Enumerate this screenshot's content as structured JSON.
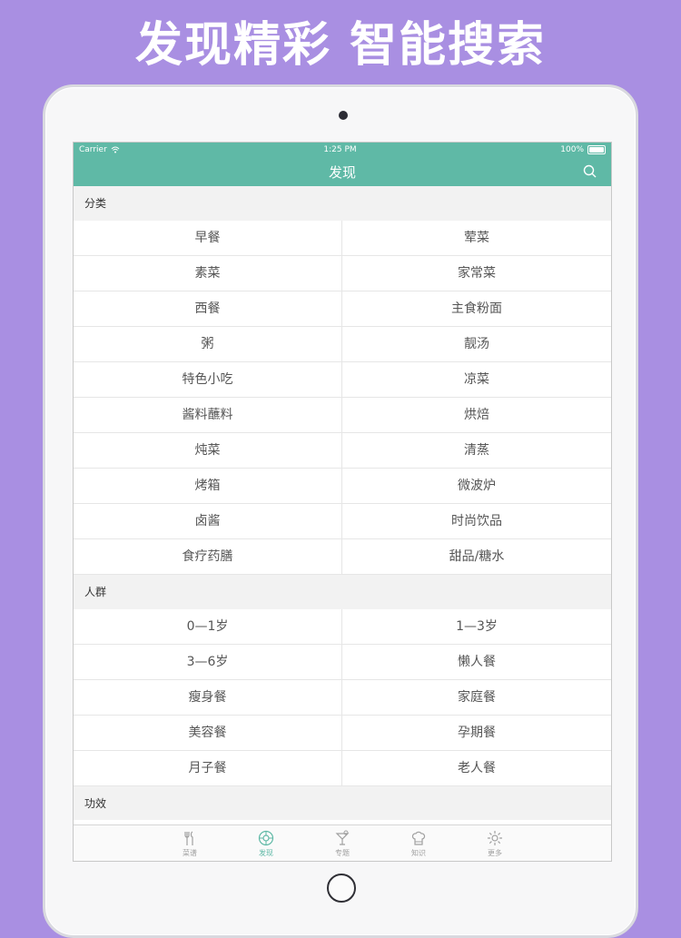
{
  "promo": {
    "title": "发现精彩 智能搜索"
  },
  "status": {
    "carrier": "Carrier",
    "time": "1:25 PM",
    "battery": "100%"
  },
  "nav": {
    "title": "发现",
    "search_icon": "search-icon"
  },
  "sections": [
    {
      "title": "分类",
      "items": [
        "早餐",
        "荤菜",
        "素菜",
        "家常菜",
        "西餐",
        "主食粉面",
        "粥",
        "靓汤",
        "特色小吃",
        "凉菜",
        "酱料蘸料",
        "烘焙",
        "炖菜",
        "清蒸",
        "烤箱",
        "微波炉",
        "卤酱",
        "时尚饮品",
        "食疗药膳",
        "甜品/糖水"
      ]
    },
    {
      "title": "人群",
      "items": [
        "0—1岁",
        "1—3岁",
        "3—6岁",
        "懒人餐",
        "瘦身餐",
        "家庭餐",
        "美容餐",
        "孕期餐",
        "月子餐",
        "老人餐"
      ]
    },
    {
      "title": "功效",
      "items": []
    }
  ],
  "tabs": [
    {
      "label": "菜谱",
      "icon": "utensils-icon",
      "active": false
    },
    {
      "label": "发现",
      "icon": "compass-icon",
      "active": true
    },
    {
      "label": "专题",
      "icon": "cocktail-icon",
      "active": false
    },
    {
      "label": "知识",
      "icon": "chef-hat-icon",
      "active": false
    },
    {
      "label": "更多",
      "icon": "gear-icon",
      "active": false
    }
  ],
  "colors": {
    "accent": "#5fb9a6",
    "background": "#a98fe2"
  }
}
